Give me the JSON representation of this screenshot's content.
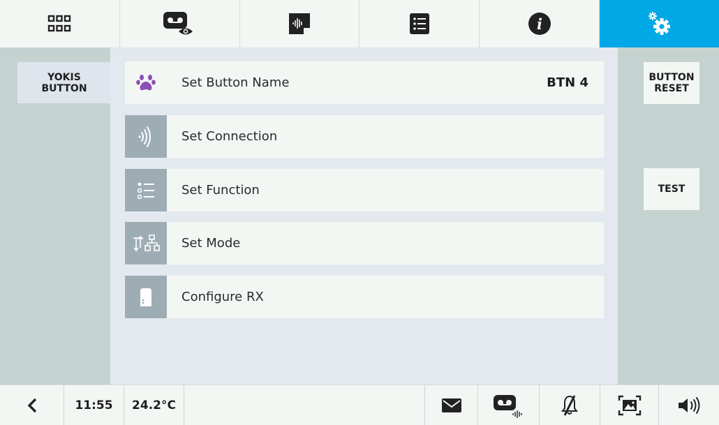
{
  "topbar": {
    "tabs": [
      {
        "icon": "app-grid-icon",
        "active": false
      },
      {
        "icon": "voicemail-view-icon",
        "active": false
      },
      {
        "icon": "audio-message-icon",
        "active": false
      },
      {
        "icon": "list-icon",
        "active": false
      },
      {
        "icon": "info-icon",
        "active": false
      },
      {
        "icon": "settings-gears-icon",
        "active": true
      }
    ],
    "accent_color": "#00a8e6"
  },
  "left_panel": {
    "button_label": "YOKIS\nBUTTON"
  },
  "menu": {
    "items": [
      {
        "icon": "paw-icon",
        "label": "Set Button Name",
        "value": "BTN 4"
      },
      {
        "icon": "wireless-signal-icon",
        "label": "Set Connection",
        "value": ""
      },
      {
        "icon": "function-list-icon",
        "label": "Set Function",
        "value": ""
      },
      {
        "icon": "mode-hierarchy-icon",
        "label": "Set Mode",
        "value": ""
      },
      {
        "icon": "receiver-module-icon",
        "label": "Configure RX",
        "value": ""
      }
    ]
  },
  "right_panel": {
    "reset_label": "BUTTON\nRESET",
    "test_label": "TEST"
  },
  "bottombar": {
    "time": "11:55",
    "temperature": "24.2°C",
    "icons": [
      "back-arrow-icon",
      "mail-icon",
      "voicemail-audio-icon",
      "bell-muted-icon",
      "picture-frame-icon",
      "speaker-icon"
    ]
  }
}
